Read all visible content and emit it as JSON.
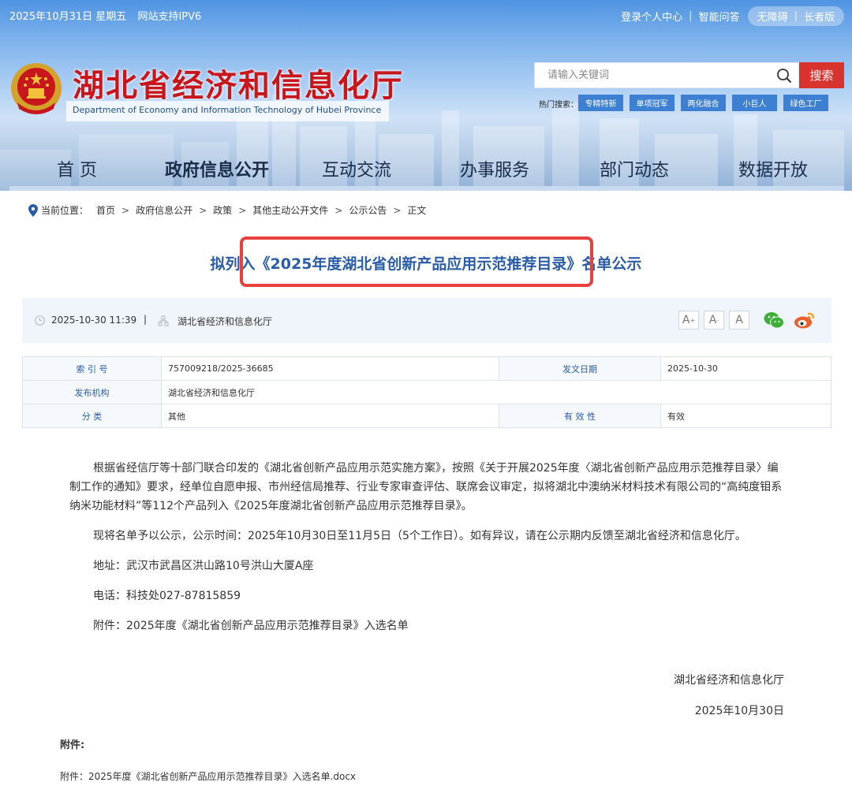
{
  "topbar": {
    "date": "2025年10月31日 星期五",
    "ipv6": "网站支持IPV6",
    "login": "登录个人中心",
    "qa": "智能问答",
    "accessible": "无障碍",
    "elder": "长者版"
  },
  "site": {
    "title": "湖北省经济和信息化厅",
    "subtitle": "Department of Economy and Information Technology of Hubei Province"
  },
  "search": {
    "placeholder": "请输入关键词",
    "button": "搜索",
    "hot_label": "热门搜索：",
    "hot_tags": [
      "专精特新",
      "单项冠军",
      "两化融合",
      "小巨人",
      "绿色工厂"
    ]
  },
  "nav": {
    "items": [
      "首 页",
      "政府信息公开",
      "互动交流",
      "办事服务",
      "部门动态",
      "数据开放"
    ]
  },
  "breadcrumb": {
    "label": "当前位置：",
    "items": [
      "首页",
      "政府信息公开",
      "政策",
      "其他主动公开文件",
      "公示公告",
      "正文"
    ]
  },
  "article": {
    "title": "拟列入《2025年度湖北省创新产品应用示范推荐目录》名单公示",
    "datetime": "2025-10-30 11:39",
    "source": "湖北省经济和信息化厅",
    "font_large": "A",
    "font_medium": "A",
    "font_small": "A"
  },
  "info_table": {
    "index_label": "索 引 号",
    "index_value": "757009218/2025-36685",
    "date_label": "发文日期",
    "date_value": "2025-10-30",
    "org_label": "发布机构",
    "org_value": "湖北省经济和信息化厅",
    "category_label": "分    类",
    "category_value": "其他",
    "validity_label": "有 效 性",
    "validity_value": "有效"
  },
  "body": {
    "p1": "根据省经信厅等十部门联合印发的《湖北省创新产品应用示范实施方案》，按照《关于开展2025年度〈湖北省创新产品应用示范推荐目录〉编制工作的通知》要求，经单位自愿申报、市州经信局推荐、行业专家审查评估、联席会议审定，拟将湖北中澳纳米材料技术有限公司的“高纯度钼系纳米功能材料”等112个产品列入《2025年度湖北省创新产品应用示范推荐目录》。",
    "p2": "现将名单予以公示，公示时间：2025年10月30日至11月5日（5个工作日）。如有异议，请在公示期内反馈至湖北省经济和信息化厅。",
    "p3": "地址：武汉市武昌区洪山路10号洪山大厦A座",
    "p4": "电话：科技处027-87815859",
    "p5": "附件：2025年度《湖北省创新产品应用示范推荐目录》入选名单",
    "sign_org": "湖北省经济和信息化厅",
    "sign_date": "2025年10月30日"
  },
  "attachment": {
    "heading": "附件:",
    "file": "附件：2025年度《湖北省创新产品应用示范推荐目录》入选名单.docx"
  },
  "colors": {
    "brand_red": "#c8161d",
    "title_blue": "#2a5ca8",
    "search_red": "#d9332e",
    "tag_blue": "#3d7fd3",
    "highlight": "#e8403a"
  }
}
